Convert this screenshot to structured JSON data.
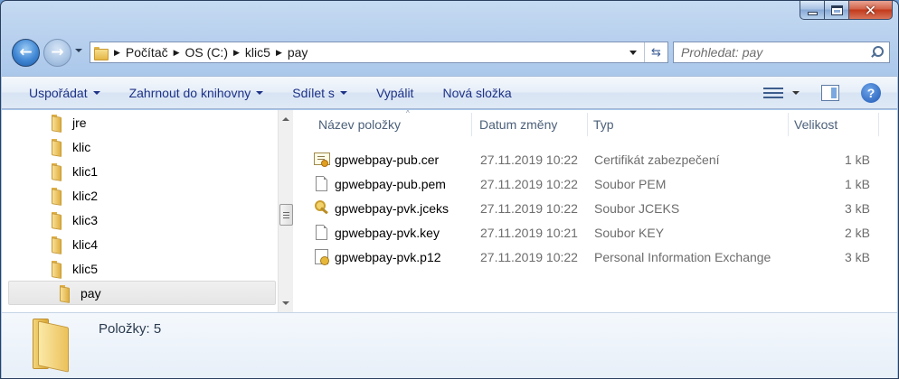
{
  "window": {
    "close_glyph": "✕"
  },
  "nav": {
    "back_arrow": "←",
    "forward_arrow": "→",
    "breadcrumbs": [
      "Počítač",
      "OS (C:)",
      "klic5",
      "pay"
    ],
    "crumb_separator": "▶",
    "refresh_glyph": "⇆",
    "search_placeholder": "Prohledat: pay"
  },
  "toolbar": {
    "organize": "Uspořádat",
    "include_library": "Zahrnout do knihovny",
    "share": "Sdílet s",
    "burn": "Vypálit",
    "new_folder": "Nová složka",
    "help": "?"
  },
  "tree": {
    "items": [
      {
        "label": "jre"
      },
      {
        "label": "klic"
      },
      {
        "label": "klic1"
      },
      {
        "label": "klic2"
      },
      {
        "label": "klic3"
      },
      {
        "label": "klic4"
      },
      {
        "label": "klic5"
      },
      {
        "label": "pay",
        "selected": true
      }
    ]
  },
  "columns": {
    "name": "Název položky",
    "date": "Datum změny",
    "type": "Typ",
    "size": "Velikost",
    "sort_glyph": "^"
  },
  "files": [
    {
      "name": "gpwebpay-pub.cer",
      "date": "27.11.2019 10:22",
      "type": "Certifikát zabezpečení",
      "size": "1 kB",
      "icon": "certificate-icon"
    },
    {
      "name": "gpwebpay-pub.pem",
      "date": "27.11.2019 10:22",
      "type": "Soubor PEM",
      "size": "1 kB",
      "icon": "file-icon"
    },
    {
      "name": "gpwebpay-pvk.jceks",
      "date": "27.11.2019 10:22",
      "type": "Soubor JCEKS",
      "size": "3 kB",
      "icon": "key-icon"
    },
    {
      "name": "gpwebpay-pvk.key",
      "date": "27.11.2019 10:21",
      "type": "Soubor KEY",
      "size": "2 kB",
      "icon": "file-icon"
    },
    {
      "name": "gpwebpay-pvk.p12",
      "date": "27.11.2019 10:22",
      "type": "Personal Information Exchange",
      "size": "3 kB",
      "icon": "pfx-icon"
    }
  ],
  "details": {
    "items_count": "Položky: 5"
  }
}
